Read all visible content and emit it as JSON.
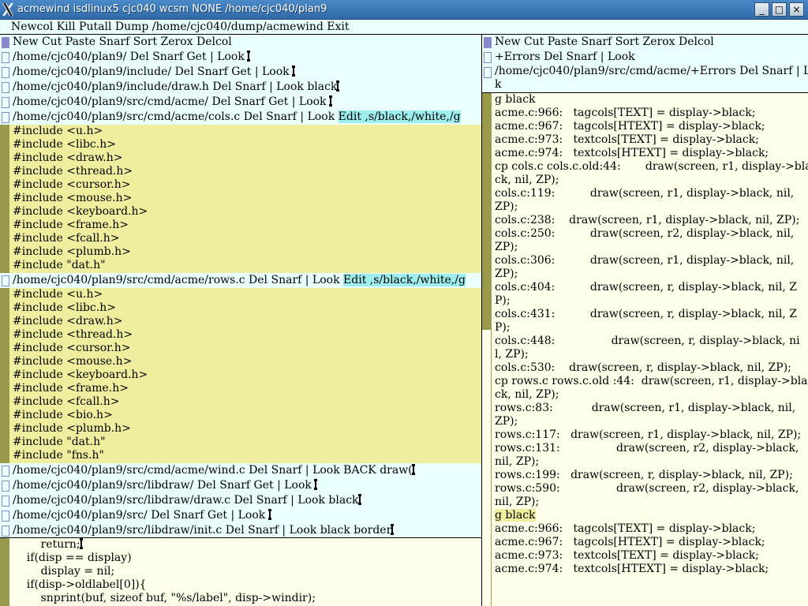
{
  "window": {
    "title": "acmewind isdlinux5 cjc040 wcsm NONE /home/cjc040/plan9",
    "minimize": "_",
    "maximize": "□",
    "close": "×"
  },
  "row_tag": "Newcol Kill Putall Dump /home/cjc040/dump/acmewind Exit",
  "left_col": {
    "tag": "New Cut Paste Snarf Sort Zerox Delcol",
    "windows": [
      {
        "tag": "/home/cjc040/plan9/ Del Snarf Get | Look "
      },
      {
        "tag": "/home/cjc040/plan9/include/ Del Snarf Get | Look "
      },
      {
        "tag": "/home/cjc040/plan9/include/draw.h Del Snarf | Look black"
      },
      {
        "tag": "/home/cjc040/plan9/src/cmd/acme/ Del Snarf Get | Look "
      },
      {
        "tag": "/home/cjc040/plan9/src/cmd/acme/cols.c Del Snarf | Look ",
        "sel": "Edit ,s/black,/white,/g"
      }
    ],
    "cols_body": [
      "#include <u.h>",
      "#include <libc.h>",
      "#include <draw.h>",
      "#include <thread.h>",
      "#include <cursor.h>",
      "#include <mouse.h>",
      "#include <keyboard.h>",
      "#include <frame.h>",
      "#include <fcall.h>",
      "#include <plumb.h>",
      "#include \"dat.h\""
    ],
    "rows_tag": {
      "tag": "/home/cjc040/plan9/src/cmd/acme/rows.c Del Snarf | Look ",
      "sel": "Edit ,s/black,/white,/g"
    },
    "rows_body": [
      "#include <u.h>",
      "#include <libc.h>",
      "#include <draw.h>",
      "#include <thread.h>",
      "#include <cursor.h>",
      "#include <mouse.h>",
      "#include <keyboard.h>",
      "#include <frame.h>",
      "#include <fcall.h>",
      "#include <bio.h>",
      "#include <plumb.h>",
      "#include \"dat.h\"",
      "#include \"fns.h\""
    ],
    "lower_windows": [
      {
        "tag": "/home/cjc040/plan9/src/cmd/acme/wind.c Del Snarf | Look BACK draw("
      },
      {
        "tag": "/home/cjc040/plan9/src/libdraw/ Del Snarf Get | Look "
      },
      {
        "tag": "/home/cjc040/plan9/src/libdraw/draw.c Del Snarf | Look black"
      },
      {
        "tag": "/home/cjc040/plan9/src/ Del Snarf Get | Look "
      },
      {
        "tag": "/home/cjc040/plan9/src/libdraw/init.c Del Snarf | Look black border"
      }
    ],
    "init_body": [
      "        return;",
      "    if(disp == display)",
      "        display = nil;",
      "    if(disp->oldlabel[0]){",
      "        snprint(buf, sizeof buf, \"%s/label\", disp->windir);"
    ]
  },
  "right_col": {
    "tag": "New Cut Paste Snarf Sort Zerox Delcol",
    "errors_tag": "+Errors Del Snarf | Look",
    "errors_tag2": "/home/cjc040/plan9/src/cmd/acme/+Errors Del Snarf | Loo",
    "errors_tag2b": "k",
    "body": [
      {
        "t": "g black",
        "hl": false
      },
      {
        "t": "acme.c:966:   tagcols[TEXT] = display->black;"
      },
      {
        "t": "acme.c:967:   tagcols[HTEXT] = display->black;"
      },
      {
        "t": "acme.c:973:   textcols[TEXT] = display->black;"
      },
      {
        "t": "acme.c:974:   textcols[HTEXT] = display->black;"
      },
      {
        "t": "cp cols.c cols.c.old:44:       draw(screen, r1, display->bla"
      },
      {
        "t": "ck, nil, ZP);"
      },
      {
        "t": "cols.c:119:          draw(screen, r1, display->black, nil,"
      },
      {
        "t": "ZP);"
      },
      {
        "t": "cols.c:238:    draw(screen, r1, display->black, nil, ZP);"
      },
      {
        "t": "cols.c:250:          draw(screen, r2, display->black, nil,"
      },
      {
        "t": "ZP);"
      },
      {
        "t": "cols.c:306:          draw(screen, r1, display->black, nil,"
      },
      {
        "t": "ZP);"
      },
      {
        "t": "cols.c:404:          draw(screen, r, display->black, nil, Z"
      },
      {
        "t": "P);"
      },
      {
        "t": "cols.c:431:          draw(screen, r, display->black, nil, Z"
      },
      {
        "t": "P);"
      },
      {
        "t": "cols.c:448:                draw(screen, r, display->black, ni"
      },
      {
        "t": "l, ZP);"
      },
      {
        "t": "cols.c:530:    draw(screen, r, display->black, nil, ZP);"
      },
      {
        "t": "cp rows.c rows.c.old :44:  draw(screen, r1, display->bla"
      },
      {
        "t": "ck, nil, ZP);"
      },
      {
        "t": "rows.c:83:           draw(screen, r1, display->black, nil,"
      },
      {
        "t": "ZP);"
      },
      {
        "t": "rows.c:117:   draw(screen, r1, display->black, nil, ZP);"
      },
      {
        "t": "rows.c:131:                draw(screen, r2, display->black,"
      },
      {
        "t": "nil, ZP);"
      },
      {
        "t": "rows.c:199:   draw(screen, r, display->black, nil, ZP);"
      },
      {
        "t": "rows.c:590:                draw(screen, r2, display->black,"
      },
      {
        "t": "nil, ZP);"
      },
      {
        "t": "g black",
        "hl": true
      },
      {
        "t": "acme.c:966:   tagcols[TEXT] = display->black;"
      },
      {
        "t": "acme.c:967:   tagcols[HTEXT] = display->black;"
      },
      {
        "t": "acme.c:973:   textcols[TEXT] = display->black;"
      },
      {
        "t": "acme.c:974:   textcols[HTEXT] = display->black;"
      }
    ]
  },
  "colors": {
    "tag_bg": "#eaffff",
    "body_bg": "#ffffea",
    "selected_bg": "#eeee9e",
    "scrollbar": "#99994c",
    "tag_selection": "#9eeeee",
    "box_border": "#8888cc"
  }
}
